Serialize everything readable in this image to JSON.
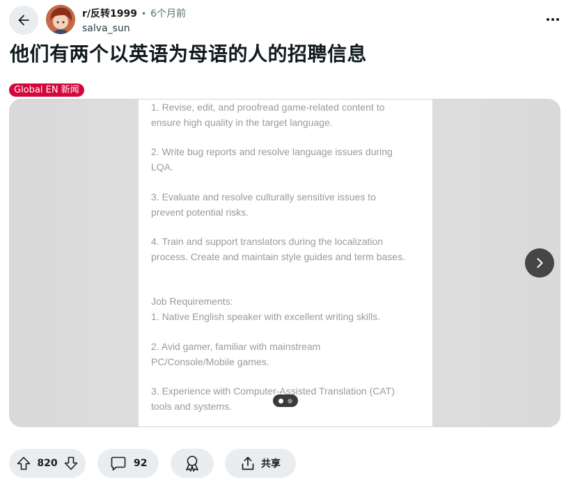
{
  "post": {
    "subreddit": "r/反转1999",
    "separator": "•",
    "time": "6个月前",
    "author": "salva_sun",
    "title": "他们有两个以英语为母语的人的招聘信息",
    "flair": "Global EN 新闻"
  },
  "image": {
    "paragraphs": [
      {
        "lines": [
          "1. Revise, edit, and proofread game-related content to",
          "ensure high quality in the target language."
        ]
      },
      {
        "lines": [
          "2. Write bug reports and resolve language issues during",
          "LQA."
        ]
      },
      {
        "lines": [
          "3. Evaluate and resolve culturally sensitive issues to",
          "prevent potential risks."
        ]
      },
      {
        "lines": [
          "4. Train and support translators during the localization",
          "process. Create and maintain style guides and term bases."
        ]
      },
      {
        "lines": [
          "Job Requirements:",
          "1. Native English speaker with excellent writing skills."
        ]
      },
      {
        "lines": [
          "2. Avid gamer, familiar with mainstream",
          "PC/Console/Mobile games."
        ]
      },
      {
        "lines": [
          "3. Experience with Computer-Assisted Translation (CAT)",
          "tools and systems."
        ]
      }
    ],
    "pager": {
      "current": 1,
      "total": 2
    }
  },
  "actions": {
    "upvotes": "820",
    "comments": "92",
    "share_label": "共享"
  },
  "icons": [
    "back-arrow-icon",
    "more-icon",
    "chevron-right-icon",
    "upvote-icon",
    "downvote-icon",
    "comment-icon",
    "award-icon",
    "share-icon"
  ],
  "colors": {
    "flair_bg": "#d4063b",
    "pill_bg": "#eaedef",
    "nav_button": "#464646"
  }
}
